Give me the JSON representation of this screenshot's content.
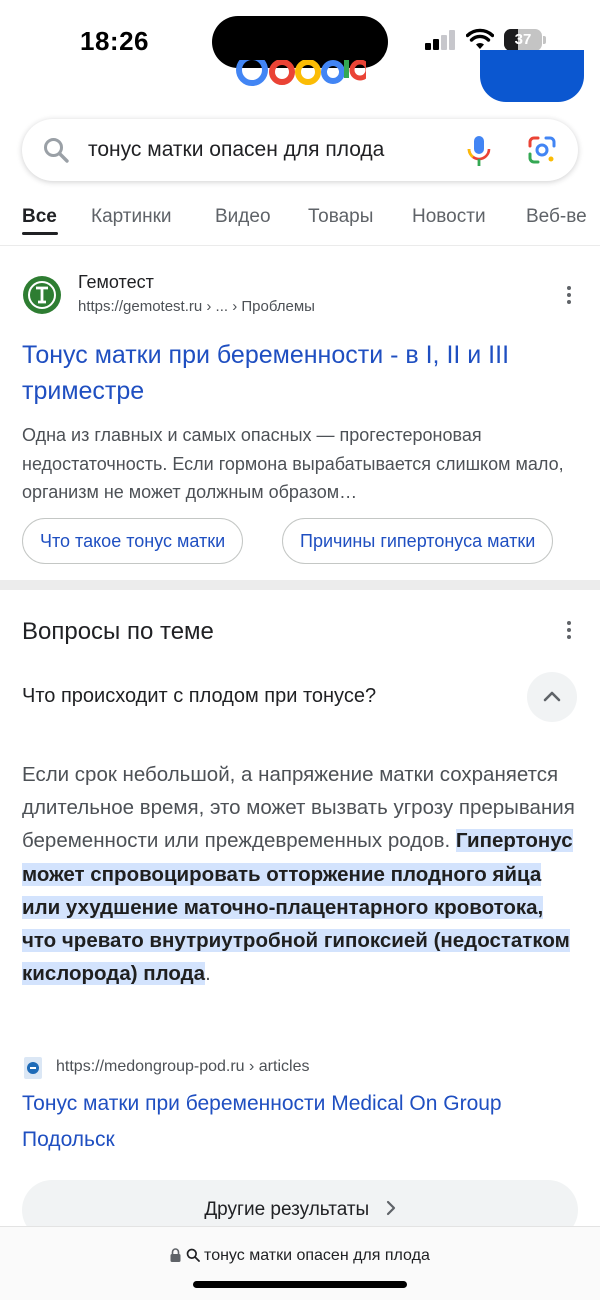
{
  "status": {
    "time": "18:26",
    "battery": "37",
    "battery_level": 0.37
  },
  "search": {
    "query": "тонус матки опасен для плода",
    "icons": [
      "search-icon",
      "mic-icon",
      "google-lens-icon"
    ]
  },
  "tabs": [
    {
      "label": "Все",
      "active": true
    },
    {
      "label": "Картинки"
    },
    {
      "label": "Видео"
    },
    {
      "label": "Товары"
    },
    {
      "label": "Новости"
    },
    {
      "label": "Веб-ве"
    }
  ],
  "result": {
    "site": "Гемотест",
    "url": "https://gemotest.ru › ... › Проблемы",
    "title": "Тонус матки при беременности - в I, II и III триместре",
    "snippet": "Одна из главных и самых опасных — прогестероновая недостаточность. Если гормона вырабатывается слишком мало, организм не может должным образом…",
    "chips": [
      "Что такое тонус матки",
      "Причины гипертонуса матки"
    ],
    "brand_color": "#2e7d32"
  },
  "paa": {
    "heading": "Вопросы по теме",
    "question": "Что происходит с плодом при тонусе?",
    "answer_plain": "Если срок небольшой, а напряжение матки сохраняется длительное время, это может вызвать угрозу прерывания беременности или преждевременных родов.",
    "answer_highlight": "Гипертонус может спровоцировать отторжение плодного яйца или ухудшение маточно-плацентарного кровотока, что чревато внутриутробной гипоксией (недостатком кислорода) плода",
    "answer_end": ".",
    "source_url": "https://medongroup-pod.ru › articles",
    "source_title": "Тонус матки при беременности Medical On Group Подольск",
    "more_label": "Другие результаты"
  },
  "address_bar": {
    "text": "тонус матки опасен для плода"
  },
  "colors": {
    "link": "#1f4fc1",
    "highlight": "#d3e3fd",
    "accent_button": "#0b57d0"
  }
}
